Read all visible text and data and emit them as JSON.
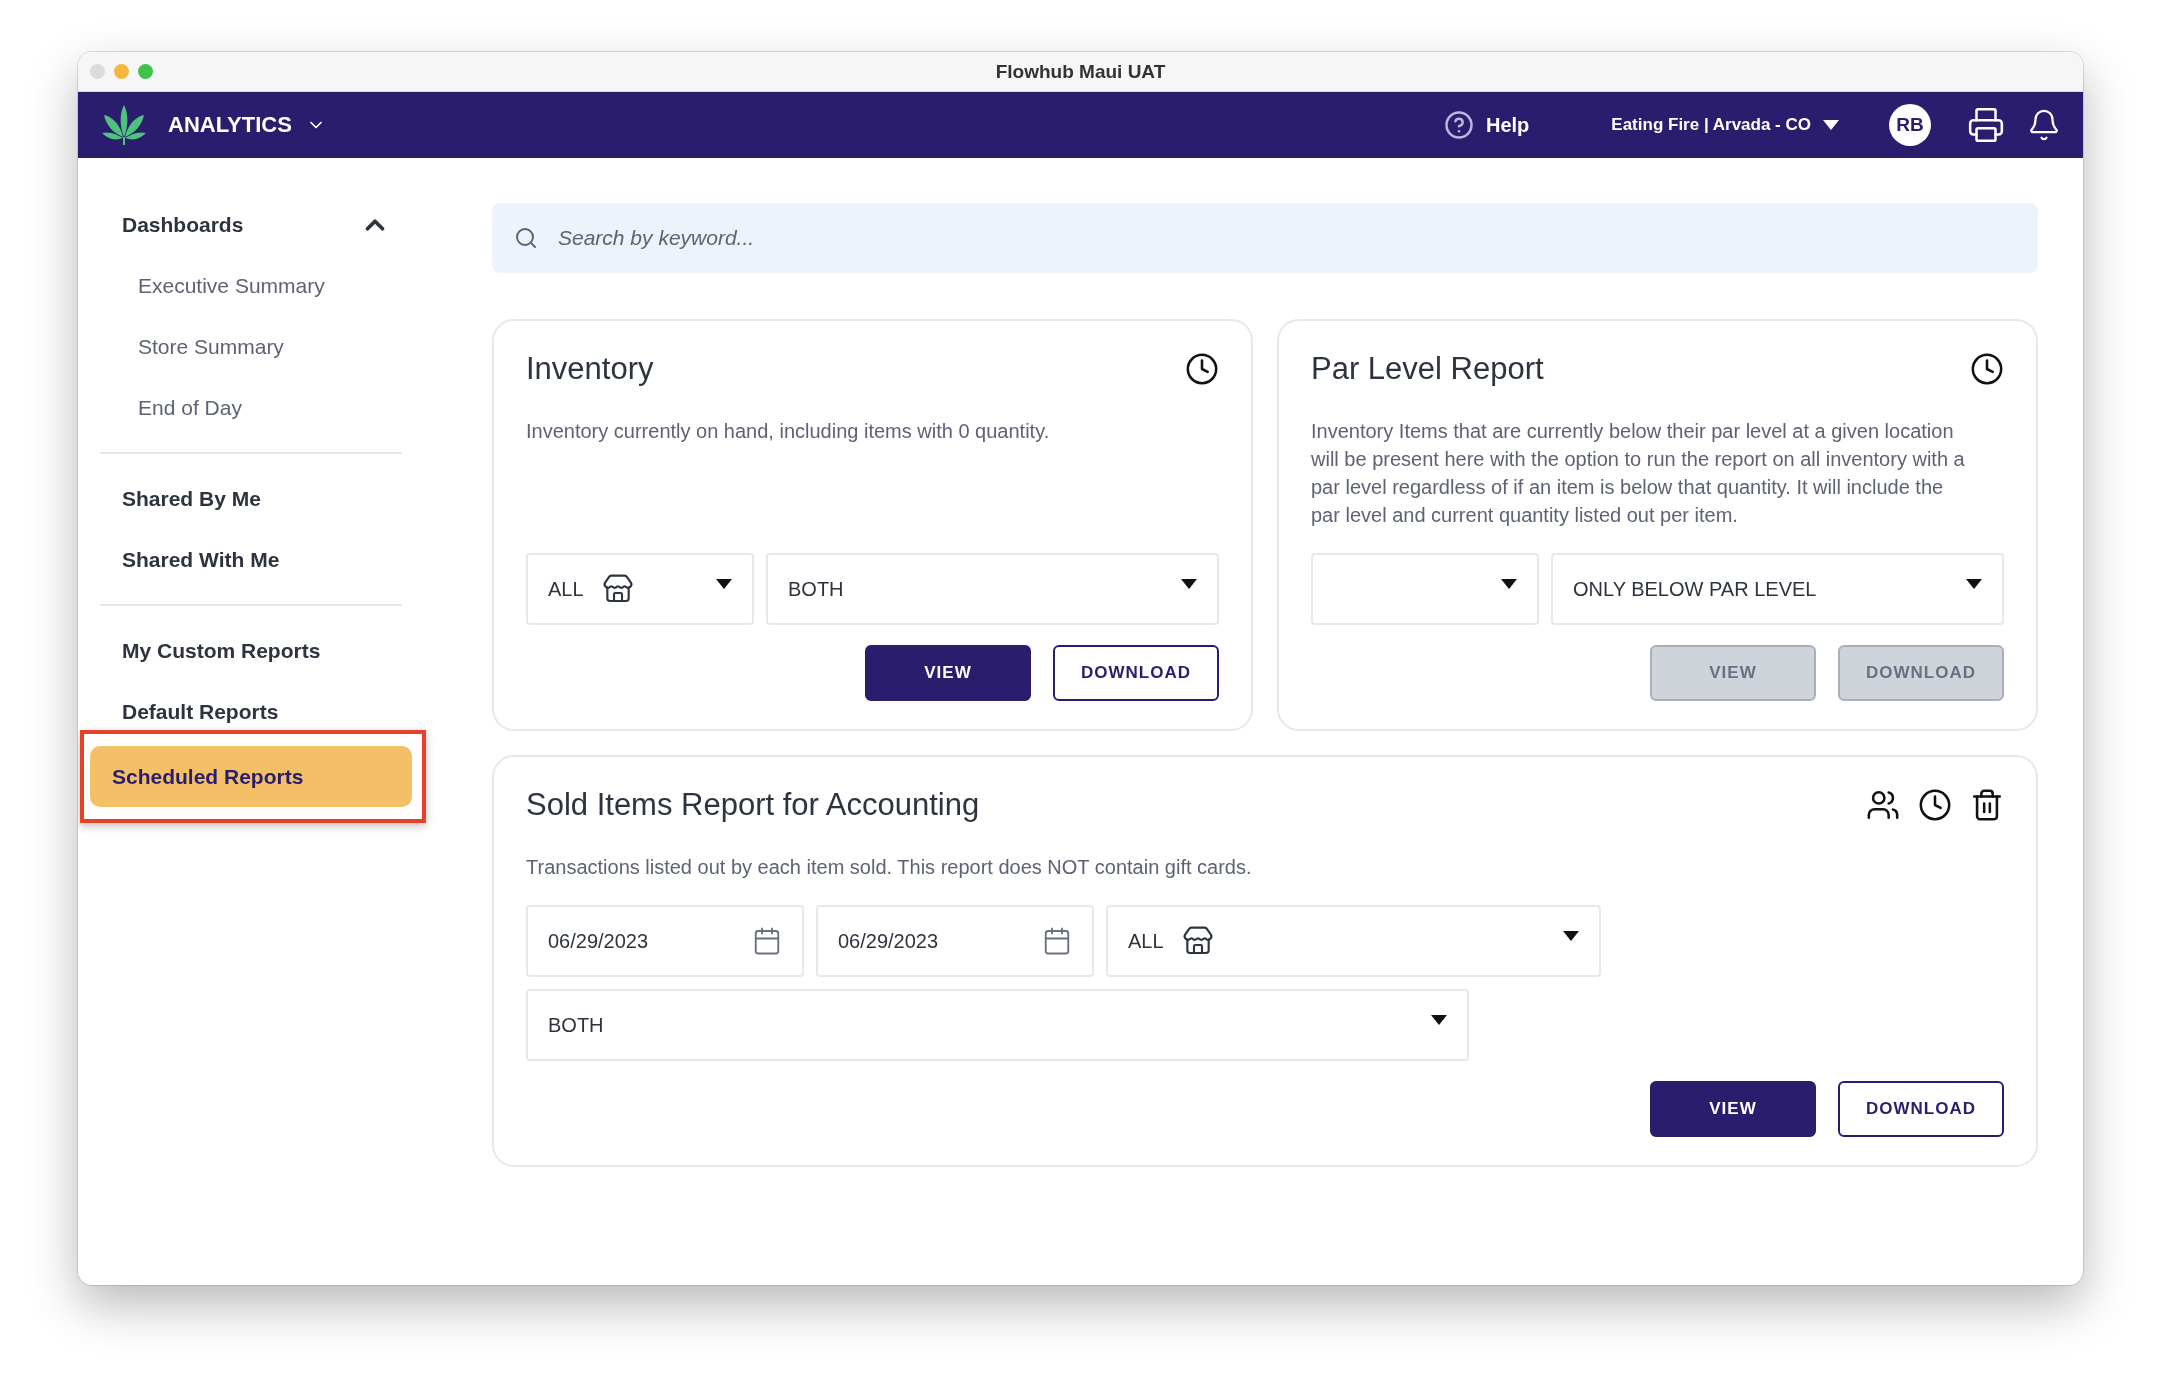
{
  "window": {
    "title": "Flowhub Maui UAT"
  },
  "navbar": {
    "app": "ANALYTICS",
    "help": "Help",
    "location": "Eating Fire | Arvada - CO",
    "avatar": "RB"
  },
  "sidebar": {
    "sections": [
      {
        "items": [
          {
            "label": "Dashboards",
            "expanded": true,
            "selected": false,
            "annotated": false,
            "children": [
              {
                "label": "Executive Summary",
                "selected": false
              },
              {
                "label": "Store Summary",
                "selected": false
              },
              {
                "label": "End of Day",
                "selected": false
              }
            ]
          }
        ]
      },
      {
        "items": [
          {
            "label": "Shared By Me",
            "selected": false,
            "annotated": false
          },
          {
            "label": "Shared With Me",
            "selected": false,
            "annotated": false
          }
        ]
      },
      {
        "items": [
          {
            "label": "My Custom Reports",
            "selected": false,
            "annotated": false
          },
          {
            "label": "Default Reports",
            "selected": false,
            "annotated": false
          },
          {
            "label": "Scheduled Reports",
            "selected": true,
            "annotated": true
          }
        ]
      }
    ]
  },
  "search": {
    "placeholder": "Search by keyword..."
  },
  "cards": [
    {
      "title": "Inventory",
      "icons": [
        {
          "kind": "clock"
        }
      ],
      "description": "Inventory currently on hand, including items with 0 quantity.",
      "rows": [
        [
          {
            "kind": "select",
            "value": "ALL",
            "store_icon": true
          },
          {
            "kind": "select",
            "value": "BOTH",
            "store_icon": false
          }
        ]
      ],
      "buttons": [
        {
          "label": "VIEW",
          "kind": "primary",
          "disabled": false
        },
        {
          "label": "DOWNLOAD",
          "kind": "outline",
          "disabled": false
        }
      ]
    },
    {
      "title": "Par Level Report",
      "icons": [
        {
          "kind": "clock"
        }
      ],
      "description": "Inventory Items that are currently below their par level at a given location will be present here with the option to run the report on all inventory with a par level regardless of if an item is below that quantity. It will include the par level and current quantity listed out per item.",
      "rows": [
        [
          {
            "kind": "select",
            "store_icon": false
          },
          {
            "kind": "select",
            "value": "ONLY BELOW PAR LEVEL",
            "store_icon": false
          }
        ]
      ],
      "buttons": [
        {
          "label": "VIEW",
          "kind": "primary",
          "disabled": true
        },
        {
          "label": "DOWNLOAD",
          "kind": "outline",
          "disabled": true
        }
      ]
    },
    {
      "title": "Sold Items Report for Accounting",
      "icons": [
        {
          "kind": "people"
        },
        {
          "kind": "clock"
        },
        {
          "kind": "trash"
        }
      ],
      "description": "Transactions listed out by each item sold. This report does NOT contain gift cards.",
      "rows": [
        [
          {
            "kind": "date",
            "value": "06/29/2023"
          },
          {
            "kind": "date",
            "value": "06/29/2023"
          },
          {
            "kind": "select",
            "value": "ALL",
            "store_icon": true
          }
        ],
        [
          {
            "kind": "select",
            "value": "BOTH",
            "store_icon": false
          }
        ]
      ],
      "buttons": [
        {
          "label": "VIEW",
          "kind": "primary",
          "disabled": false
        },
        {
          "label": "DOWNLOAD",
          "kind": "outline",
          "disabled": false
        }
      ]
    }
  ]
}
